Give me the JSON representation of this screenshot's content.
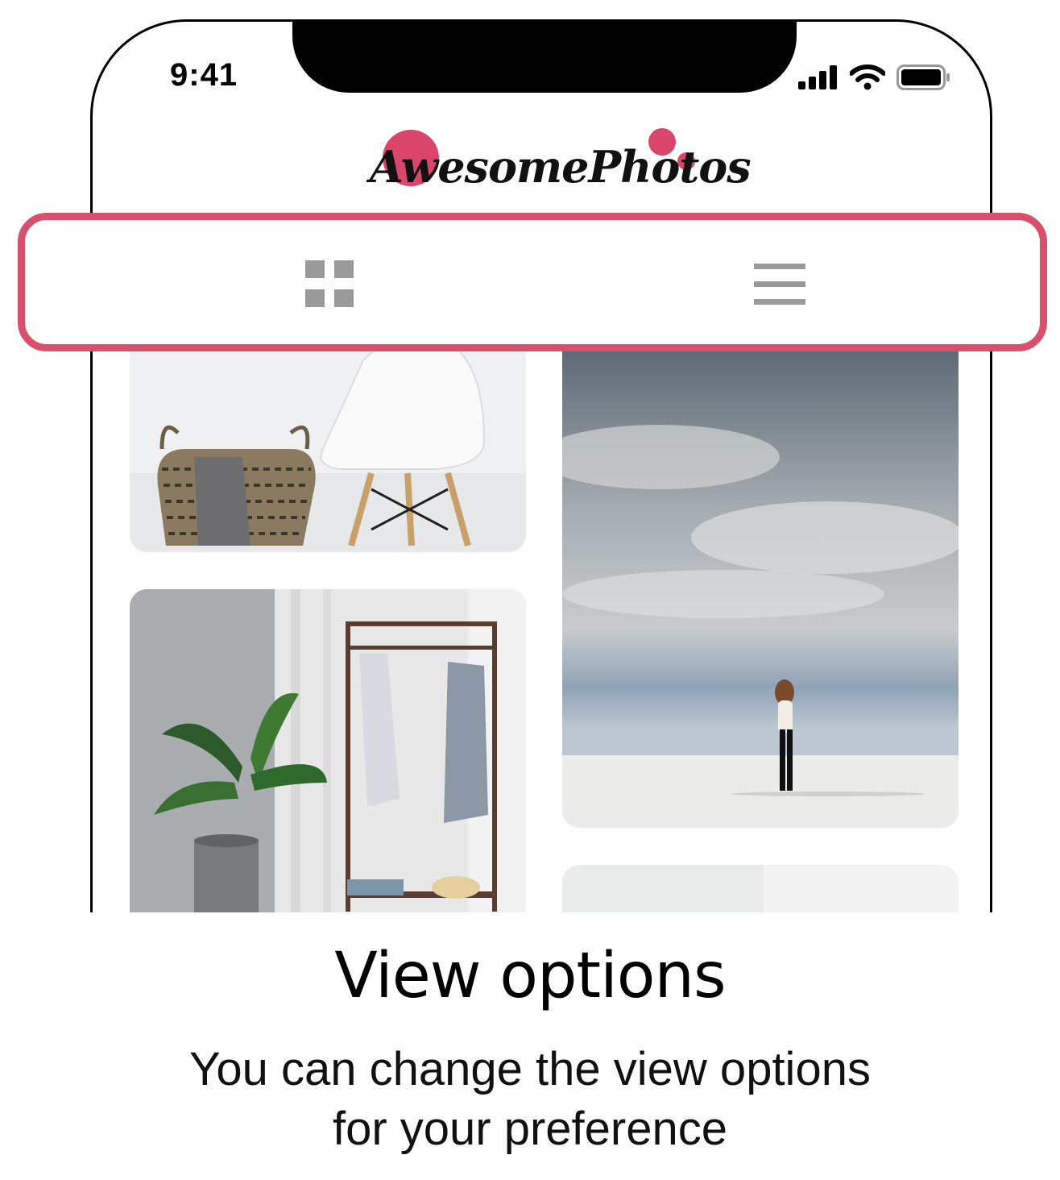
{
  "status_bar": {
    "time": "9:41"
  },
  "app": {
    "logo_text": "AwesomePhotos",
    "accent_color": "#d9456b"
  },
  "view_toggle": {
    "grid_icon": "grid-view-icon",
    "list_icon": "list-view-icon",
    "highlight_color": "#d9506c"
  },
  "gallery": {
    "photos": [
      {
        "subject": "basket-and-chair"
      },
      {
        "subject": "clothes-rack-with-plant"
      },
      {
        "subject": "person-under-cloudy-sky"
      },
      {
        "subject": "white-interior"
      }
    ]
  },
  "caption": {
    "title": "View options",
    "line1": "You can change the view options",
    "line2": "for your preference"
  }
}
